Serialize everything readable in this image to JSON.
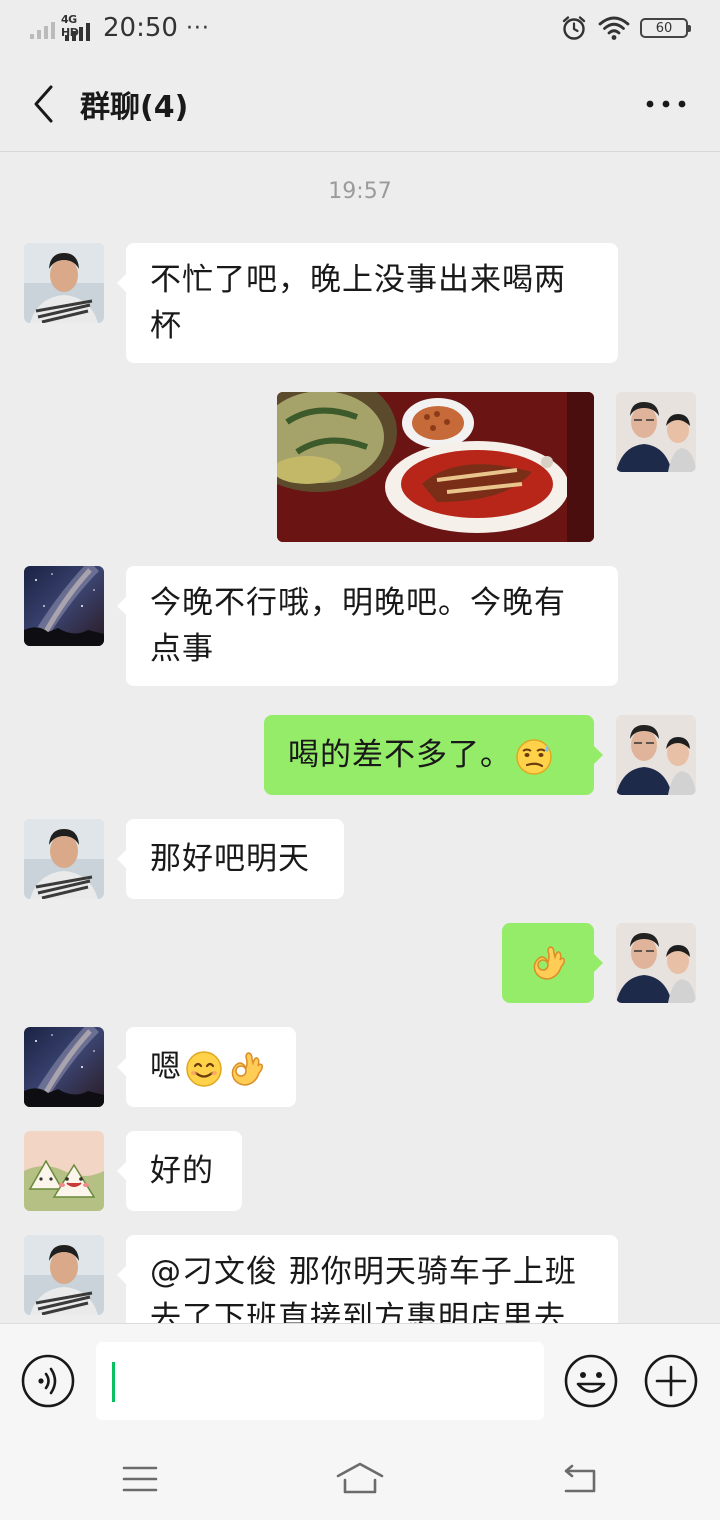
{
  "status_bar": {
    "network_type": "4G HD",
    "time": "20:50",
    "more_indicator": "···",
    "battery_level": "60"
  },
  "header": {
    "title": "群聊(4)"
  },
  "chat": {
    "timestamp": "19:57",
    "messages": [
      {
        "side": "left",
        "sender_avatar": "young-man-avatar",
        "text": "不忙了吧，晚上没事出来喝两杯"
      },
      {
        "side": "right",
        "sender_avatar": "man-and-child-avatar",
        "type": "image",
        "image_description_icon": "food-photo"
      },
      {
        "side": "left",
        "sender_avatar": "milky-way-avatar",
        "text": "今晚不行哦，明晚吧。今晚有点事"
      },
      {
        "side": "right",
        "sender_avatar": "man-and-child-avatar",
        "text": "喝的差不多了。",
        "emoji": "sweat-smirk-emoji"
      },
      {
        "side": "left",
        "sender_avatar": "young-man-avatar",
        "text": "那好吧明天"
      },
      {
        "side": "right",
        "sender_avatar": "man-and-child-avatar",
        "emoji": "ok-hand-emoji"
      },
      {
        "side": "left",
        "sender_avatar": "milky-way-avatar",
        "text": "嗯",
        "emoji": "smile-emoji + ok-hand-emoji"
      },
      {
        "side": "left",
        "sender_avatar": "zongzi-avatar",
        "text": "好的"
      },
      {
        "side": "left",
        "sender_avatar": "young-man-avatar",
        "text": "@刁文俊  那你明天骑车子上班去了下班直接到方惠明店里去"
      }
    ]
  },
  "input_bar": {
    "value": "",
    "icons": [
      "voice-icon",
      "emoji-icon",
      "plus-icon"
    ]
  },
  "system_nav": {
    "icons": [
      "menu-icon",
      "home-icon",
      "back-icon"
    ]
  },
  "colors": {
    "background": "#ededed",
    "sent_bubble": "#95ec69",
    "received_bubble": "#ffffff",
    "caret": "#07c160"
  }
}
